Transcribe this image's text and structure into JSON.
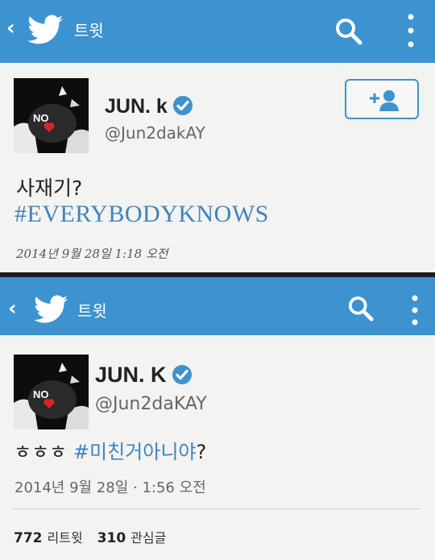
{
  "tweet1": {
    "header": {
      "title": "트윗"
    },
    "user": {
      "name": "JUN. k",
      "handle": "@Jun2dakAY",
      "avatar_text": "NO"
    },
    "text": "사재기?",
    "hashtag": "#EVERYBODYKNOWS",
    "timestamp": "2014년 9월 28일   1:18 오전"
  },
  "tweet2": {
    "header": {
      "title": "트윗"
    },
    "user": {
      "name": "JUN. K",
      "handle": "@Jun2daKAY",
      "avatar_text": "NO"
    },
    "text": "ㅎㅎㅎ",
    "hashtag": "#미친거아니야",
    "text_suffix": "?",
    "timestamp": "2014년 9월 28일 · 1:56 오전",
    "stats": {
      "retweets_count": "772",
      "retweets_label": "리트윗",
      "favorites_count": "310",
      "favorites_label": "관심글"
    }
  },
  "colors": {
    "accent": "#3d93cf",
    "hashtag": "#3f84bd",
    "background": "#f3f3f1"
  },
  "icons": [
    "back-icon",
    "twitter-bird-icon",
    "search-icon",
    "overflow-menu-icon",
    "verified-badge-icon",
    "follow-user-icon"
  ]
}
